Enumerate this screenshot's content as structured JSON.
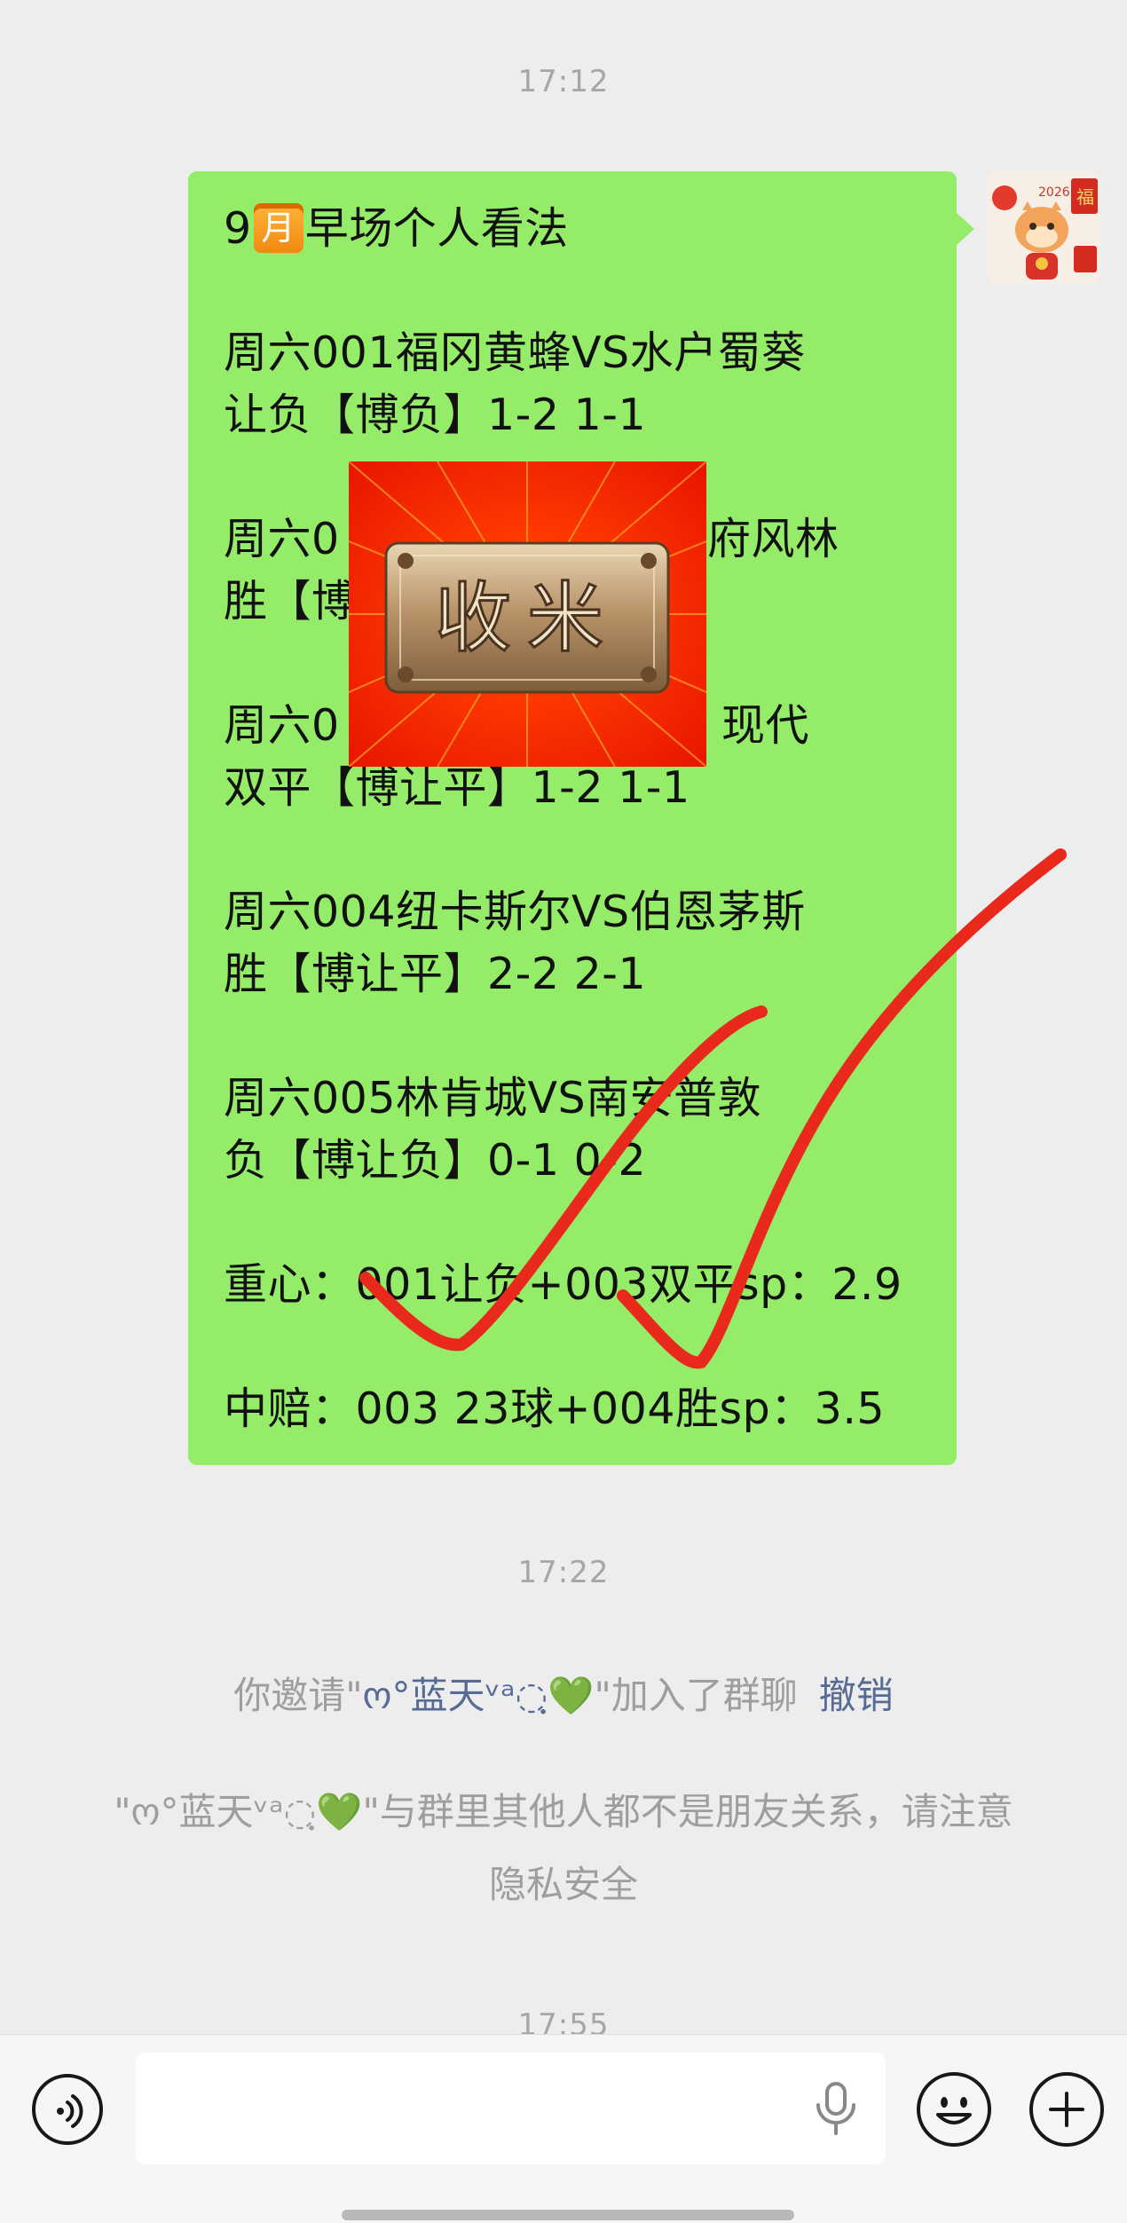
{
  "chat": {
    "timestamps": [
      "17:12",
      "17:22",
      "17:55"
    ],
    "message": {
      "title_prefix": "9",
      "title_badge": "月",
      "title_suffix": "早场个人看法",
      "lines": [
        "周六001福冈黄蜂VS水户蜀葵",
        "让负【博负】1-2 1-1",
        "周六0",
        "府风林",
        "胜【博",
        "周六0",
        "现代",
        "双平【博让平】1-2 1-1",
        "周六004纽卡斯尔VS伯恩茅斯",
        "胜【博让平】2-2 2-1",
        "周六005林肯城VS南安普敦",
        "负【博让负】0-1 0-2",
        "重心：001让负+003双平sp：2.9",
        "中赔：003 23球+004胜sp：3.5"
      ],
      "stamp_text": "收米"
    },
    "avatar": {
      "year": "2026",
      "fu_char": "福"
    },
    "system": {
      "invite_prefix": "你邀请\"",
      "invite_name": "ო°蓝天ᵛᵃ◌ฺ💚",
      "invite_suffix": "\"加入了群聊",
      "revoke_label": "撤销",
      "privacy_line1": "\"ო°蓝天ᵛᵃ◌ฺ💚\"与群里其他人都不是朋友关系，请注意",
      "privacy_line2": "隐私安全"
    }
  },
  "input_bar": {
    "voice_icon": "voice-toggle-icon",
    "mic_icon": "microphone-icon",
    "emoji_icon": "emoji-icon",
    "plus_icon": "plus-icon"
  },
  "colors": {
    "bubble": "#95ec69",
    "background": "#ededed",
    "link": "#576b95",
    "check_red": "#e8291c"
  }
}
